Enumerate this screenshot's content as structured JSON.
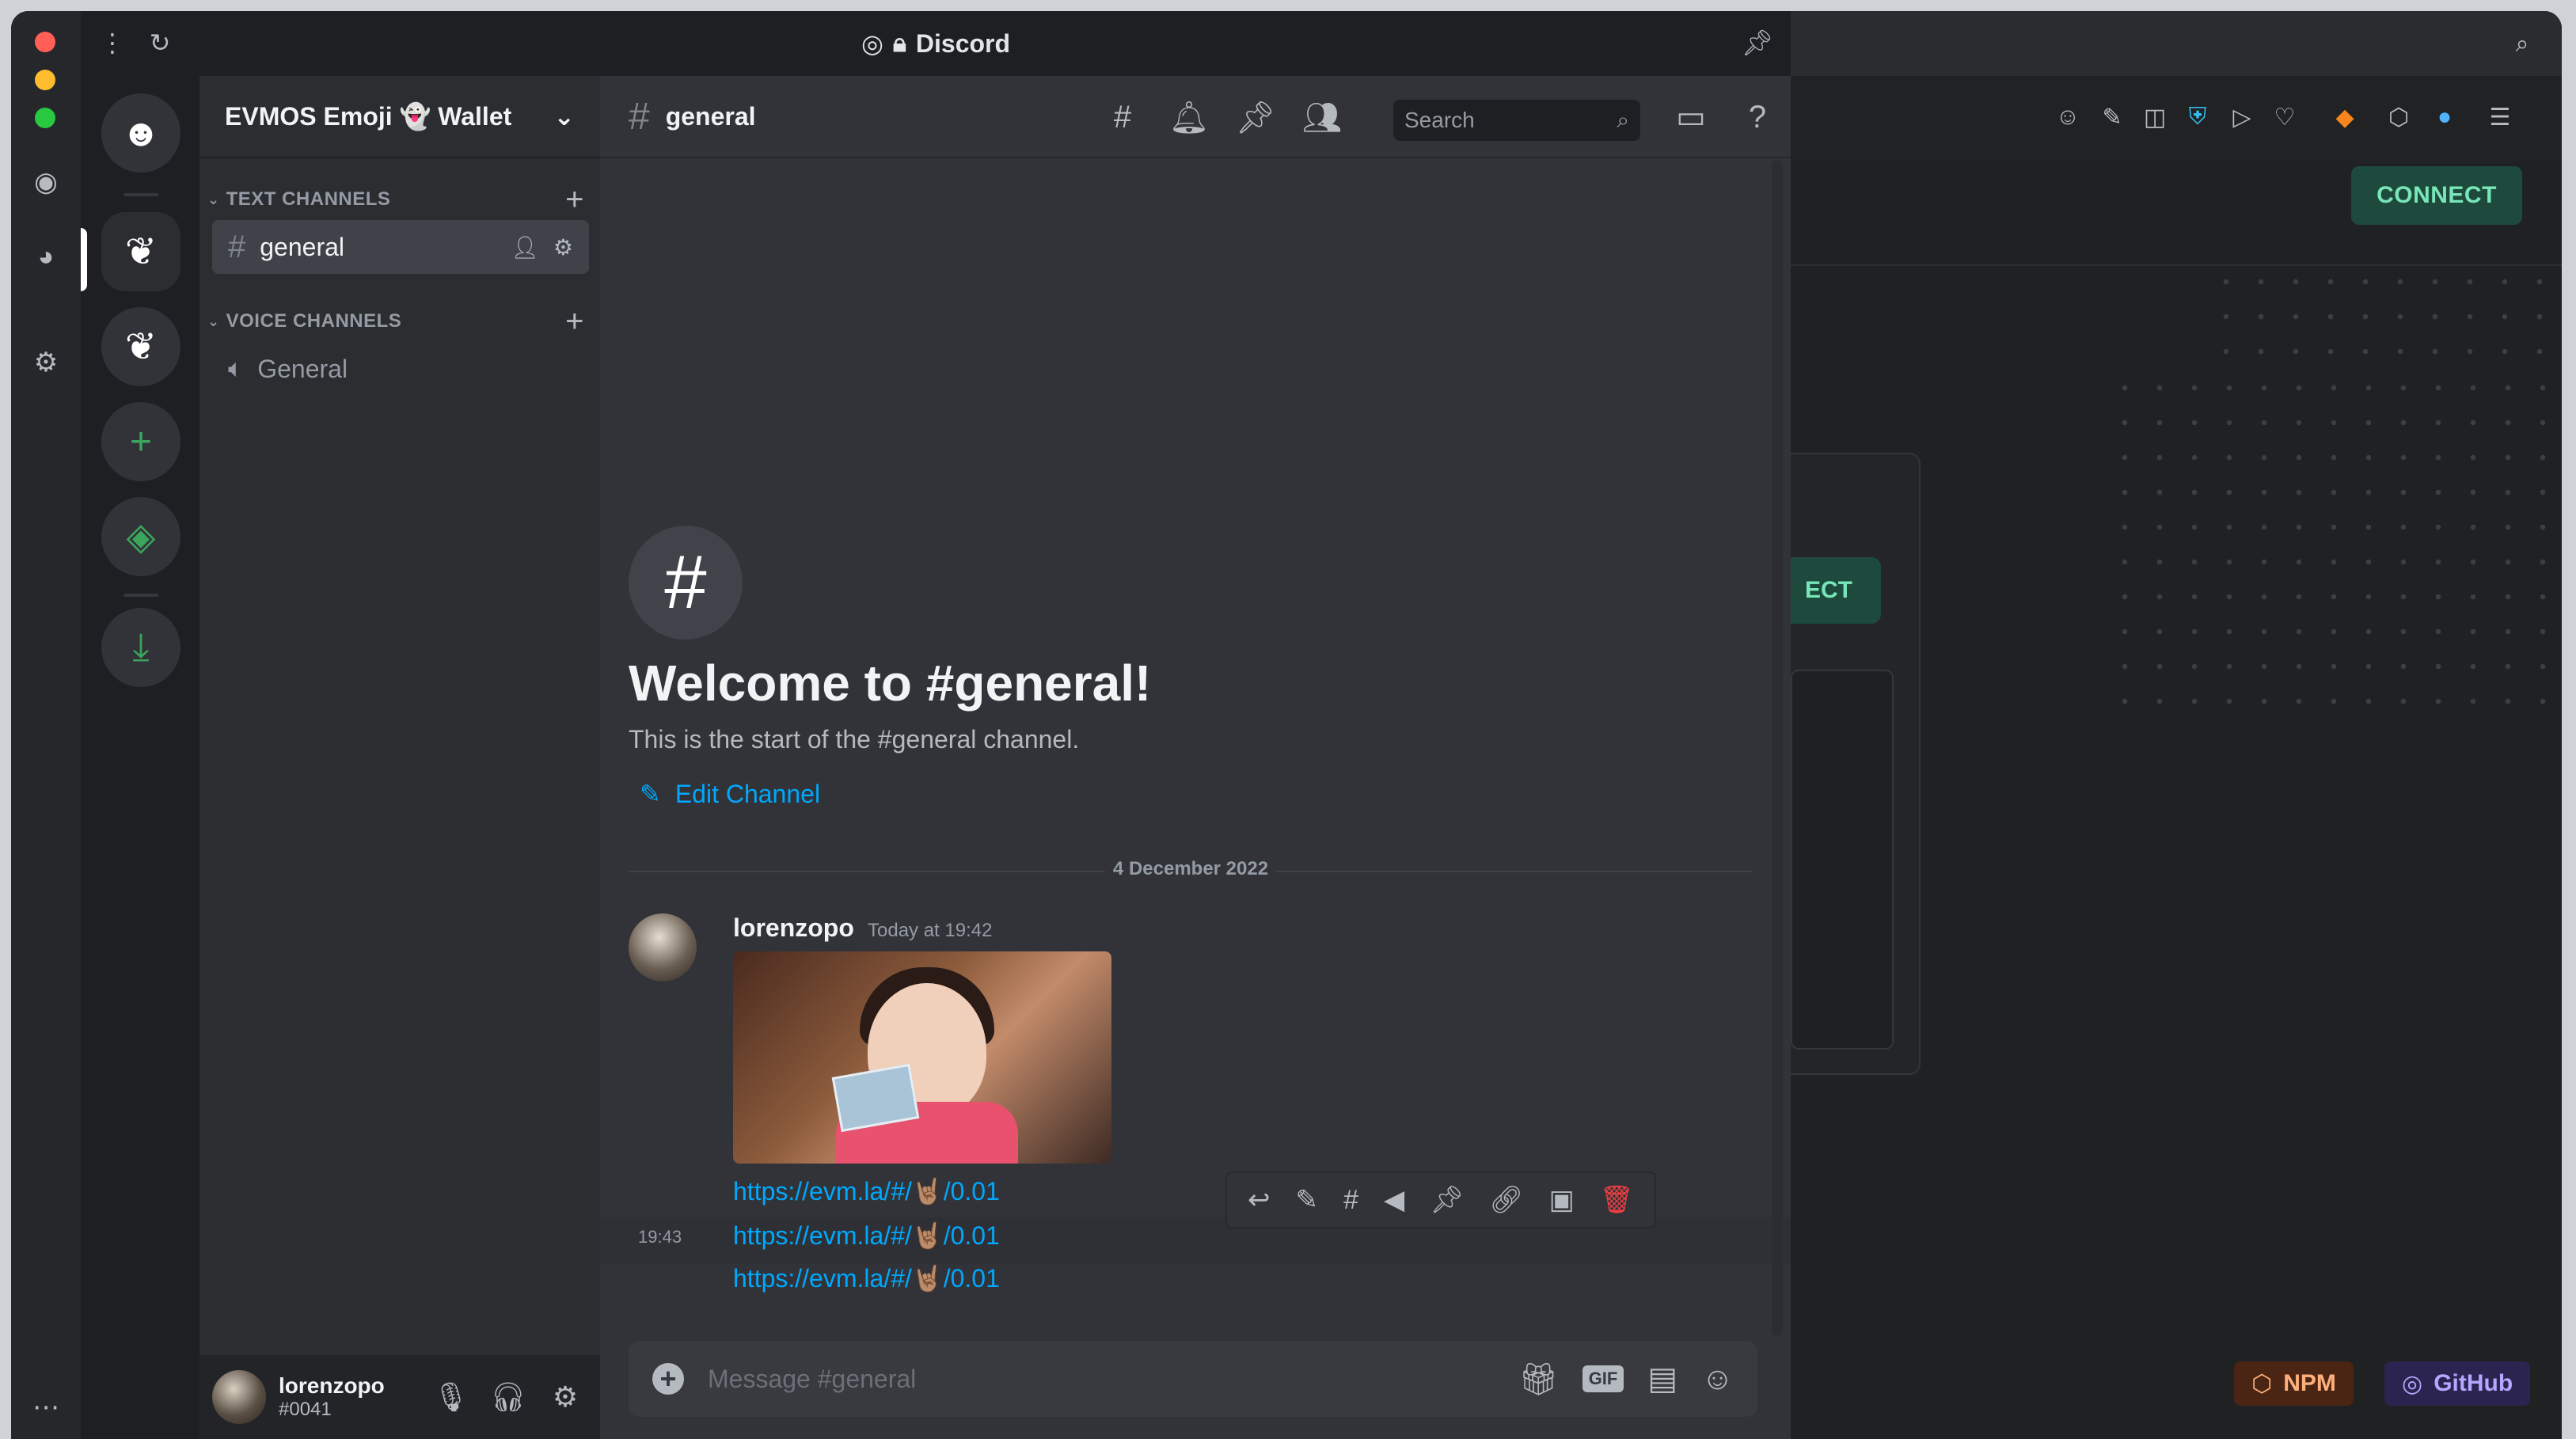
{
  "window": {
    "title": "Discord"
  },
  "server": {
    "name": "EVMOS Emoji 👻 Wallet"
  },
  "categories": {
    "text": "TEXT CHANNELS",
    "voice": "VOICE CHANNELS"
  },
  "channels": {
    "text_general": "general",
    "voice_general": "General"
  },
  "chat": {
    "channel_name": "general",
    "search_placeholder": "Search",
    "welcome_title": "Welcome to #general!",
    "welcome_sub": "This is the start of the #general channel.",
    "edit_channel": "Edit Channel",
    "date_divider": "4 December 2022",
    "message": {
      "author": "lorenzopo",
      "time": "Today at 19:42",
      "links": [
        "https://evm.la/#/🤘🏽/0.01",
        "https://evm.la/#/🤘🏽/0.01",
        "https://evm.la/#/🤘🏽/0.01"
      ],
      "hover_stamp": "19:43"
    },
    "composer_placeholder": "Message #general",
    "gif_label": "GIF"
  },
  "user": {
    "name": "lorenzopo",
    "tag": "#0041"
  },
  "bg_app": {
    "connect_label": "CONNECT",
    "card_btn_label": "ECT",
    "npm_label": "NPM",
    "github_label": "GitHub"
  },
  "colors": {
    "accent_link": "#00a8fc",
    "discord_green": "#3ba55c",
    "delete_red": "#f23f43",
    "connect_green": "#78e6b8"
  }
}
